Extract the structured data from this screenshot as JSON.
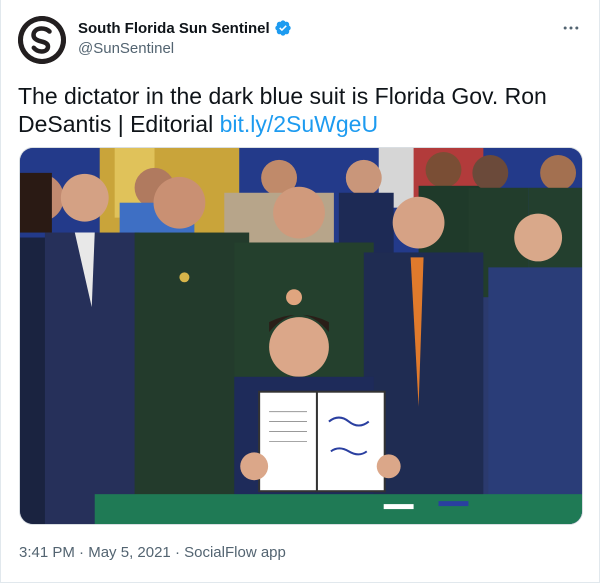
{
  "account": {
    "display_name": "South Florida Sun Sentinel",
    "handle": "@SunSentinel",
    "verified": true,
    "avatar_icon": "sun-sentinel-logo-icon"
  },
  "tweet": {
    "text": "The dictator in the dark blue suit is Florida Gov. Ron DeSantis | Editorial ",
    "link_text": "bit.ly/2SuWgeU"
  },
  "media": {
    "description_icon": "photo-bill-signing-ceremony"
  },
  "meta": {
    "time": "3:41 PM",
    "date": "May 5, 2021",
    "separator": " · ",
    "source": "SocialFlow app"
  },
  "colors": {
    "link": "#1d9bf0",
    "secondary_text": "#536471",
    "primary_text": "#0f1419",
    "verified": "#1d9bf0"
  }
}
